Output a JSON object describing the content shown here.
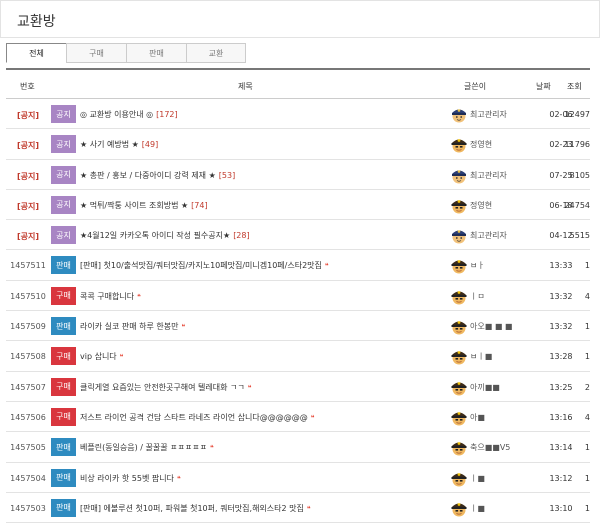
{
  "header": {
    "title": "교환방"
  },
  "tabs": [
    {
      "label": "전체",
      "active": true
    },
    {
      "label": "구매",
      "active": false
    },
    {
      "label": "판매",
      "active": false
    },
    {
      "label": "교환",
      "active": false
    }
  ],
  "columns": {
    "num": "번호",
    "subject": "제목",
    "writer": "글쓴이",
    "date": "날짜",
    "views": "조회"
  },
  "rows": [
    {
      "num": "[공지]",
      "badge": "공지",
      "subject": "◎ 교환방 이용안내 ◎",
      "comments": "[172]",
      "writer": "최고관리자",
      "avatar": "admin",
      "date": "02-06",
      "views": "12497"
    },
    {
      "num": "[공지]",
      "badge": "공지",
      "subject": "★ 사기 예방법 ★",
      "comments": "[49]",
      "writer": "정영현",
      "avatar": "officer",
      "date": "02-23",
      "views": "11796"
    },
    {
      "num": "[공지]",
      "badge": "공지",
      "subject": "★ 총판 / 홍보 / 다중아이디 강력 제재 ★",
      "comments": "[53]",
      "writer": "최고관리자",
      "avatar": "admin",
      "date": "07-25",
      "views": "8105"
    },
    {
      "num": "[공지]",
      "badge": "공지",
      "subject": "★ 먹튀/짝퉁 사이트 조회방법 ★",
      "comments": "[74]",
      "writer": "정영현",
      "avatar": "officer",
      "date": "06-18",
      "views": "24754"
    },
    {
      "num": "[공지]",
      "badge": "공지",
      "subject": "★4월12일 카카오톡 아이디 작성 필수공지★",
      "comments": "[28]",
      "writer": "최고관리자",
      "avatar": "admin",
      "date": "04-12",
      "views": "5515"
    },
    {
      "num": "1457511",
      "badge": "판매",
      "subject": "[판매] 첫10/출석맛집/쿼터맛집/카지노10페맛집/미니겜10페/스타2맛집",
      "comments": "",
      "writer": "ㅂㅏ",
      "avatar": "officer",
      "date": "13:33",
      "views": "1"
    },
    {
      "num": "1457510",
      "badge": "구매",
      "subject": "콕콕 구매합니다",
      "comments": "",
      "writer": "ㅣㅁ",
      "avatar": "officer",
      "date": "13:32",
      "views": "4"
    },
    {
      "num": "1457509",
      "badge": "판매",
      "subject": "라이카 실코 판매 하루 한봉만",
      "comments": "",
      "writer": "아오■ ■ ■",
      "avatar": "officer",
      "date": "13:32",
      "views": "1"
    },
    {
      "num": "1457508",
      "badge": "구매",
      "subject": "vip 삽니다",
      "comments": "",
      "writer": "ㅂㅣ■",
      "avatar": "officer",
      "date": "13:28",
      "views": "1"
    },
    {
      "num": "1457507",
      "badge": "구매",
      "subject": "클릭게열 요즘있는 안전한곳구해여 텔레대화 ㄱㄱ",
      "comments": "",
      "writer": "아끼■■",
      "avatar": "officer",
      "date": "13:25",
      "views": "2"
    },
    {
      "num": "1457506",
      "badge": "구매",
      "subject": "저스트 라이언 공격 건담 스타트 라네즈 라이언 삽니다@@@@@@",
      "comments": "",
      "writer": "아■",
      "avatar": "officer",
      "date": "13:16",
      "views": "4"
    },
    {
      "num": "1457505",
      "badge": "판매",
      "subject": "베플린(동일승음) / 꿀꿀꿀 ㅍㅍㅍㅍㅍ",
      "comments": "",
      "writer": "축으■■V5",
      "avatar": "officer",
      "date": "13:14",
      "views": "1"
    },
    {
      "num": "1457504",
      "badge": "판매",
      "subject": "비상 라이카 핫 55벳 팝니다",
      "comments": "",
      "writer": "ㅣ■",
      "avatar": "officer",
      "date": "13:12",
      "views": "1"
    },
    {
      "num": "1457503",
      "badge": "판매",
      "subject": "[판매] 에볼루션 첫10퍼, 파워볼 첫10퍼, 쿼터맛집,해외스타2 맛집",
      "comments": "",
      "writer": "ㅣ■",
      "avatar": "officer",
      "date": "13:10",
      "views": "1"
    }
  ]
}
